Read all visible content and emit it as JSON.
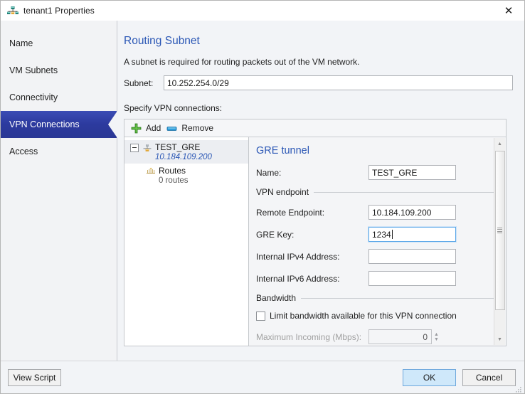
{
  "window": {
    "title": "tenant1 Properties",
    "icon": "network-tenant-icon",
    "close_label": "✕"
  },
  "sidebar": {
    "items": [
      {
        "label": "Name",
        "selected": false
      },
      {
        "label": "VM Subnets",
        "selected": false
      },
      {
        "label": "Connectivity",
        "selected": false
      },
      {
        "label": "VPN Connections",
        "selected": true
      },
      {
        "label": "Access",
        "selected": false
      }
    ]
  },
  "main": {
    "section_title": "Routing Subnet",
    "description": "A subnet is required for routing packets out of the VM network.",
    "subnet": {
      "label": "Subnet:",
      "value": "10.252.254.0/29",
      "placeholder": ""
    },
    "specify_label": "Specify VPN connections:",
    "toolbar": {
      "add_label": "Add",
      "add_icon": "plus-icon",
      "remove_label": "Remove",
      "remove_icon": "minus-icon"
    },
    "tree": {
      "root": {
        "name": "TEST_GRE",
        "address": "10.184.109.200",
        "icon": "vpn-connection-icon",
        "expander": "collapse-box"
      },
      "child": {
        "name": "Routes",
        "count_label": "0 routes",
        "icon": "routes-icon"
      }
    },
    "details": {
      "title": "GRE tunnel",
      "name_field": {
        "label": "Name:",
        "value": "TEST_GRE",
        "placeholder": ""
      },
      "endpoint_group": "VPN endpoint",
      "remote_endpoint": {
        "label": "Remote Endpoint:",
        "value": "10.184.109.200",
        "placeholder": ""
      },
      "gre_key": {
        "label": "GRE Key:",
        "value": "1234",
        "placeholder": ""
      },
      "internal_ipv4": {
        "label": "Internal IPv4 Address:",
        "value": "",
        "placeholder": ""
      },
      "internal_ipv6": {
        "label": "Internal IPv6 Address:",
        "value": "",
        "placeholder": ""
      },
      "bandwidth_group": "Bandwidth",
      "limit_checkbox": {
        "label": "Limit bandwidth available for this VPN connection",
        "checked": false
      },
      "max_incoming": {
        "label": "Maximum Incoming (Mbps):",
        "value": "0",
        "disabled": true
      }
    },
    "scrollbar": {
      "up_arrow": "▲",
      "down_arrow": "▼"
    }
  },
  "footer": {
    "view_script": "View Script",
    "ok": "OK",
    "cancel": "Cancel"
  },
  "colors": {
    "accent_blue": "#2b57b5",
    "selected_nav": "#2c3a9e",
    "add_green": "#4fb034",
    "remove_blue": "#2f9ddb",
    "default_button": "#cfe8fa"
  }
}
